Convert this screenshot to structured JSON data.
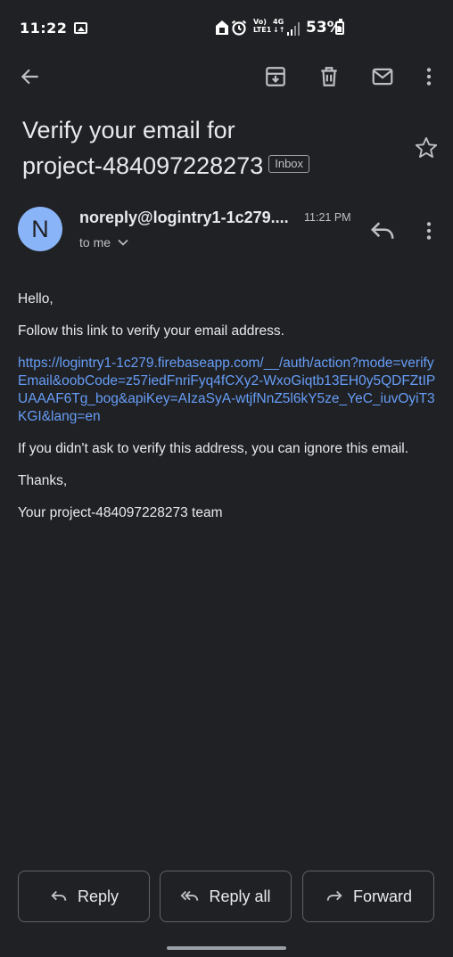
{
  "status_bar": {
    "time": "11:22",
    "network_top": "Vo)",
    "network_bottom": "LTE1",
    "network_type_top": "4G",
    "network_type_bottom": "↓↑",
    "battery": "53%"
  },
  "toolbar": {
    "back_icon": "arrow-back-icon",
    "archive_icon": "archive-icon",
    "delete_icon": "trash-icon",
    "unread_icon": "mail-icon",
    "more_icon": "more-vert-icon"
  },
  "email": {
    "subject_line1": "Verify your email for",
    "subject_line2": "project-484097228273",
    "label": "Inbox",
    "sender": {
      "initial": "N",
      "name": "noreply@logintry1-1c279....",
      "time": "11:21 PM",
      "recipient": "to me"
    },
    "body": {
      "greeting": "Hello,",
      "instruction": "Follow this link to verify your email address.",
      "link": "https://logintry1-1c279.firebaseapp.com/__/auth/action?mode=verifyEmail&oobCode=z57iedFnriFyq4fCXy2-WxoGiqtb13EH0y5QDFZtIPUAAAF6Tg_bog&apiKey=AIzaSyA-wtjfNnZ5l6kY5ze_YeC_iuvOyiT3KGI&lang=en",
      "disclaimer": "If you didn't ask to verify this address, you can ignore this email.",
      "thanks": "Thanks,",
      "signature": "Your project-484097228273 team"
    }
  },
  "actions": {
    "reply": "Reply",
    "reply_all": "Reply all",
    "forward": "Forward"
  },
  "colors": {
    "background": "#202124",
    "text": "#e8eaed",
    "link": "#669df6",
    "avatar": "#8ab4f8"
  }
}
